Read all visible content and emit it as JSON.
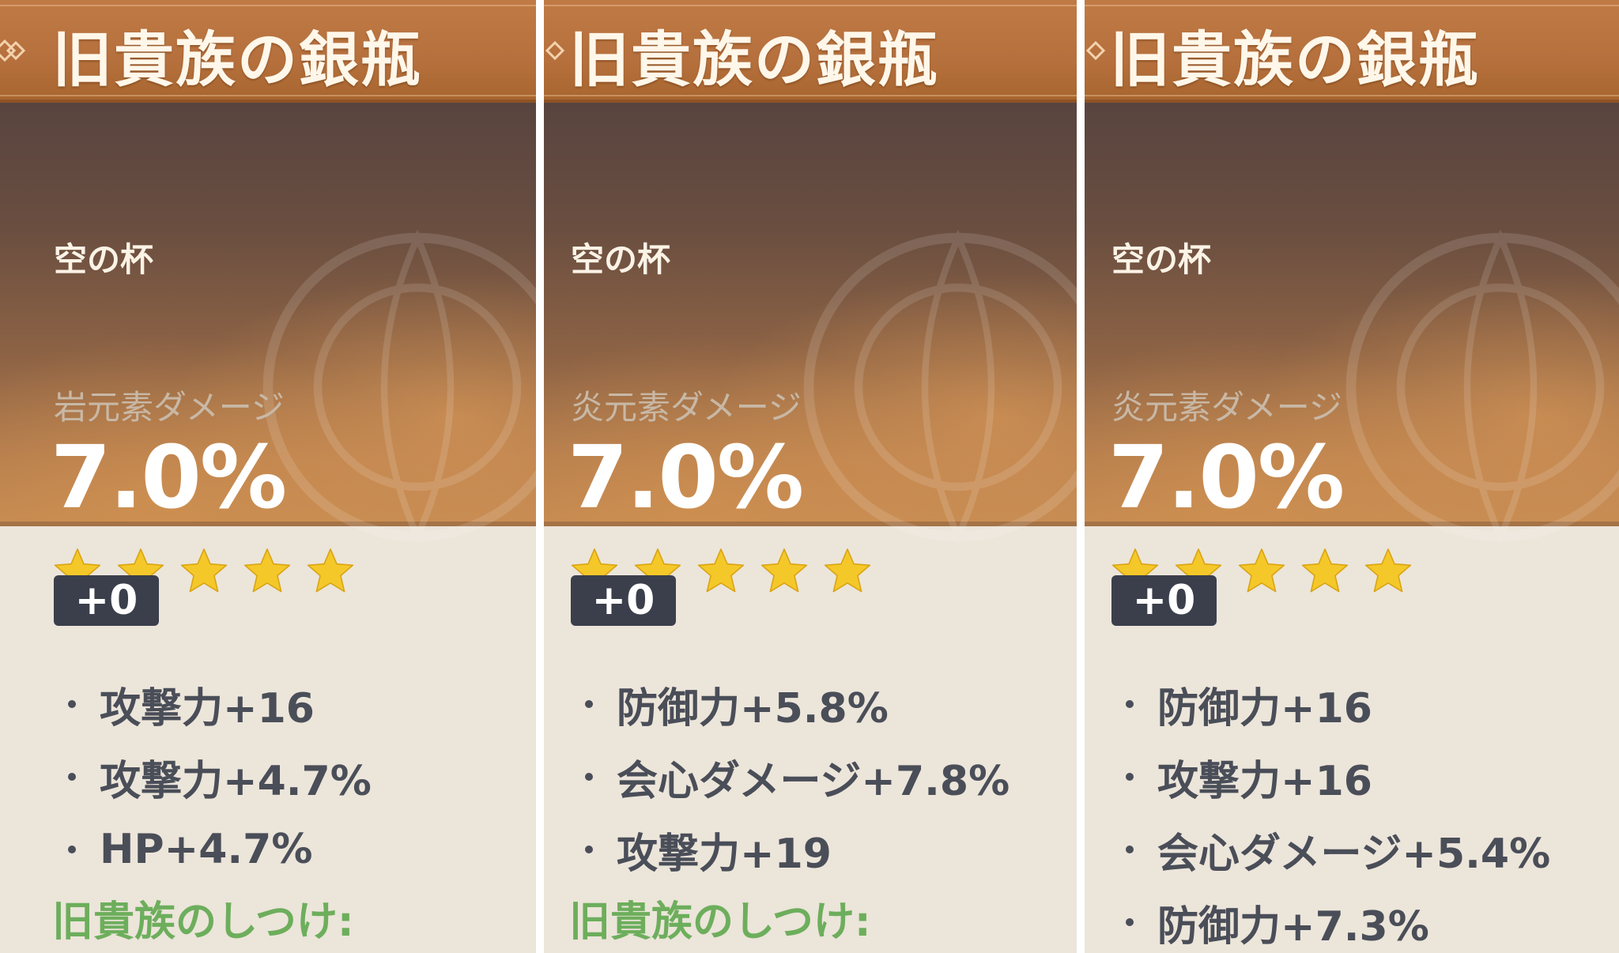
{
  "cards": [
    {
      "title": "旧貴族の銀瓶",
      "slot": "空の杯",
      "main_stat_label": "岩元素ダメージ",
      "main_stat_value": "7.0%",
      "rarity_stars": 5,
      "level": "+0",
      "substats": [
        "攻撃力+16",
        "攻撃力+4.7%",
        "HP+4.7%"
      ],
      "set_label": "旧貴族のしつけ:"
    },
    {
      "title": "旧貴族の銀瓶",
      "slot": "空の杯",
      "main_stat_label": "炎元素ダメージ",
      "main_stat_value": "7.0%",
      "rarity_stars": 5,
      "level": "+0",
      "substats": [
        "防御力+5.8%",
        "会心ダメージ+7.8%",
        "攻撃力+19"
      ],
      "set_label": "旧貴族のしつけ:"
    },
    {
      "title": "旧貴族の銀瓶",
      "slot": "空の杯",
      "main_stat_label": "炎元素ダメージ",
      "main_stat_value": "7.0%",
      "rarity_stars": 5,
      "level": "+0",
      "substats": [
        "防御力+16",
        "攻撃力+16",
        "会心ダメージ+5.4%",
        "防御力+7.3%"
      ]
    }
  ],
  "colors": {
    "header": "#b6703d",
    "star": "#f5c82a",
    "badge": "#3a3f4b",
    "substat_text": "#4a4e58",
    "set_label": "#6dae5c",
    "panel": "#ece5da"
  },
  "icons": {
    "star": "star-icon",
    "ornament": "diamond-ornament-icon"
  }
}
